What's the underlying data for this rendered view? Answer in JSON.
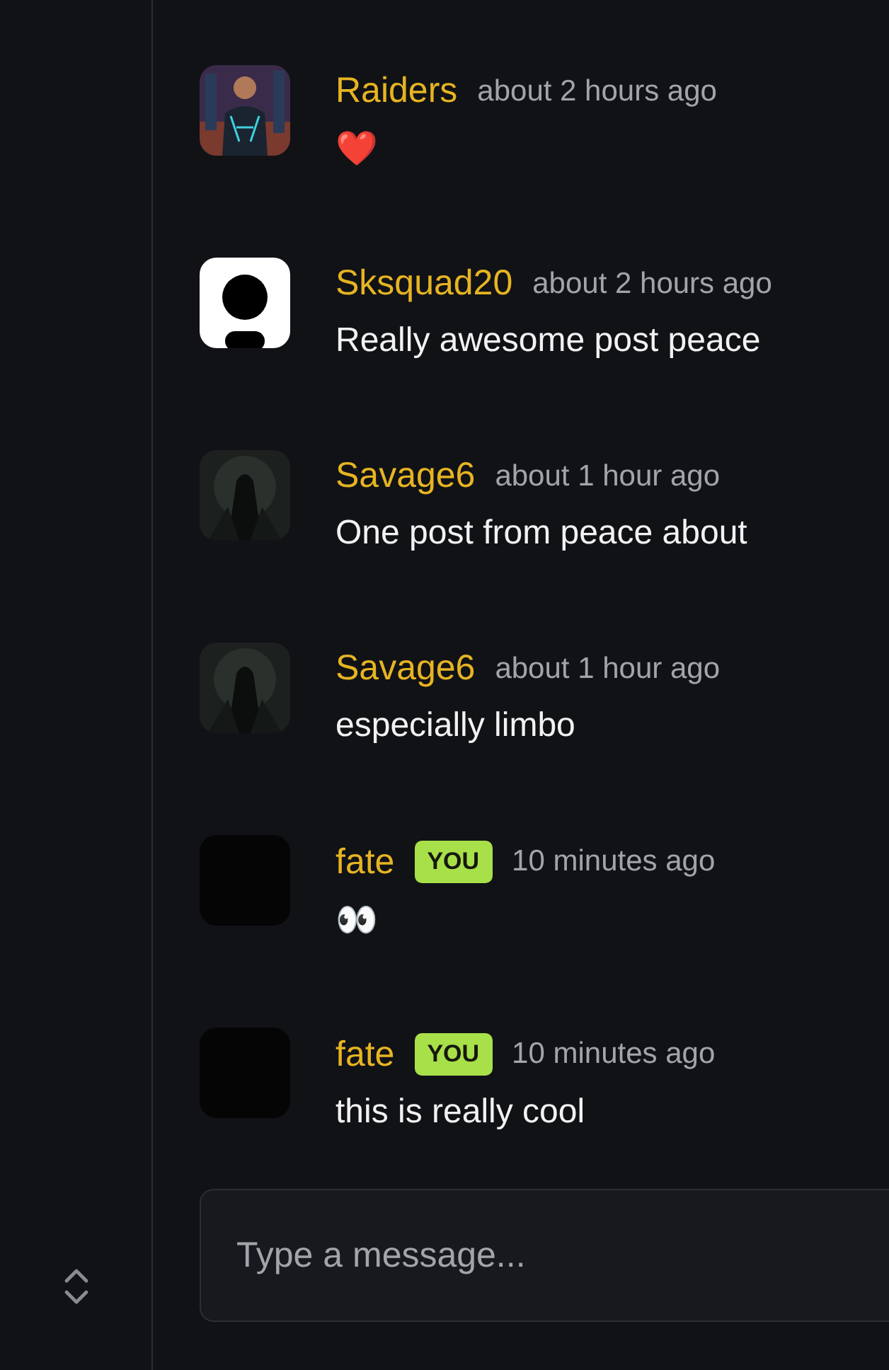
{
  "messages": [
    {
      "author": "Raiders",
      "time": "about 2 hours ago",
      "text": "❤️"
    },
    {
      "author": "Sksquad20",
      "time": "about 2 hours ago",
      "text": "Really awesome post peace",
      "avatar": {
        "kind": "silhouette"
      }
    },
    {
      "author": "Savage6",
      "time": "about 1 hour ago",
      "text": "One post from peace about",
      "avatar": {
        "kind": "dark-picture"
      }
    },
    {
      "author": "Savage6",
      "time": "about 1 hour ago",
      "text": "especially limbo",
      "avatar": {
        "kind": "dark-picture"
      }
    },
    {
      "author": "fate",
      "you_badge": "YOU",
      "time": "10 minutes ago",
      "text": "👀",
      "avatar": {
        "kind": "blank"
      }
    },
    {
      "author": "fate",
      "you_badge": "YOU",
      "time": "10 minutes ago",
      "text": "this is really cool",
      "avatar": {
        "kind": "blank"
      }
    }
  ],
  "composer": {
    "placeholder": "Type a message..."
  }
}
